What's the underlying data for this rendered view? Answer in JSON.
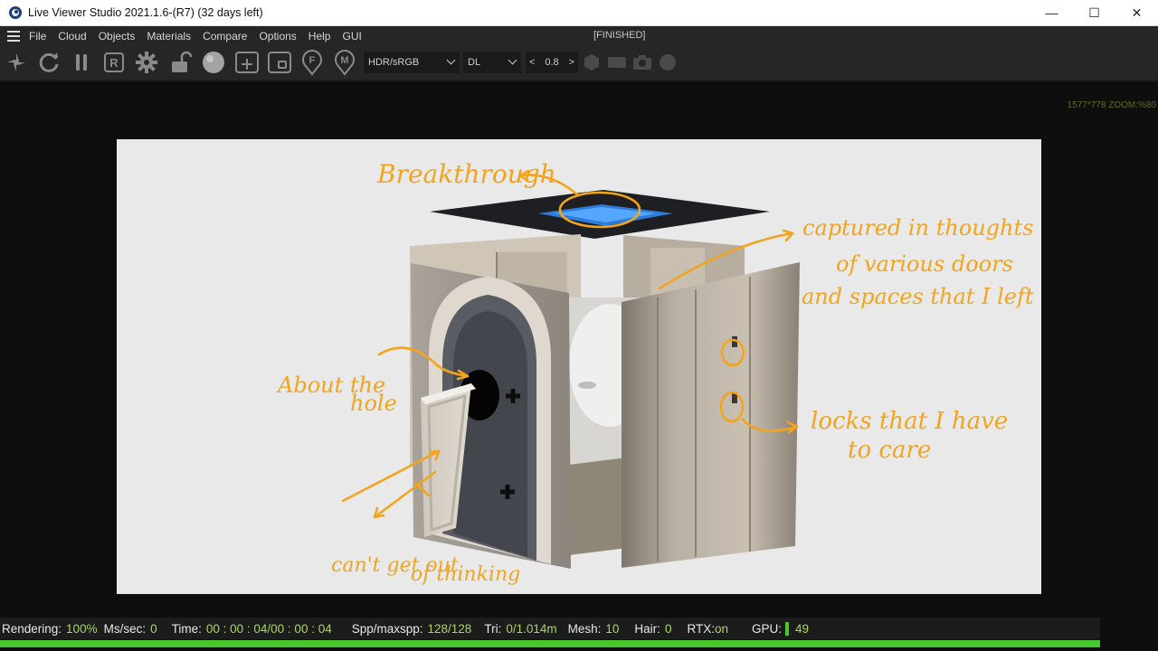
{
  "window": {
    "title": "Live Viewer Studio 2021.1.6-(R7) (32 days left)",
    "minimize": "—",
    "maximize": "☐",
    "close": "✕"
  },
  "menu": {
    "items": [
      "File",
      "Cloud",
      "Objects",
      "Materials",
      "Compare",
      "Options",
      "Help",
      "GUI"
    ],
    "status": "[FINISHED]"
  },
  "toolbar": {
    "icons": [
      "render-spinner-icon",
      "refresh-icon",
      "pause-icon",
      "r-box-icon",
      "gear-icon",
      "unlock-icon",
      "sphere-icon",
      "add-region-icon",
      "region-icon",
      "focus-pin-icon",
      "material-pin-icon"
    ],
    "tonemap": "HDR/sRGB",
    "kernel": "DL",
    "param_value": "0.8",
    "prev": "<",
    "next": ">"
  },
  "viewport": {
    "resolution_label": "1577*778 ZOOM:%80"
  },
  "annotations": {
    "breakthrough": "Breakthrough",
    "captured": [
      "captured in thoughts",
      "of various doors",
      "and spaces that I left"
    ],
    "about": [
      "About the",
      "hole"
    ],
    "locks": [
      "locks that I have",
      "to care"
    ],
    "cant": [
      "can't get out",
      "of thinking"
    ]
  },
  "status": {
    "rendering_label": "Rendering:",
    "rendering_value": "100%",
    "ms_label": "Ms/sec:",
    "ms_value": "0",
    "time_label": "Time:",
    "time_value": "00 : 00 : 04/00 : 00 : 04",
    "spp_label": "Spp/maxspp:",
    "spp_value": "128/128",
    "tri_label": "Tri:",
    "tri_value": "0/1.014m",
    "mesh_label": "Mesh:",
    "mesh_value": "10",
    "hair_label": "Hair:",
    "hair_value": "0",
    "rtx_label": "RTX:",
    "rtx_value": "on",
    "gpu_label": "GPU:",
    "gpu_value": "49",
    "progress": 1.0
  },
  "colors": {
    "annotation": "#f2a41d",
    "status_value": "#a8d85a",
    "progress": "#46c72e"
  }
}
